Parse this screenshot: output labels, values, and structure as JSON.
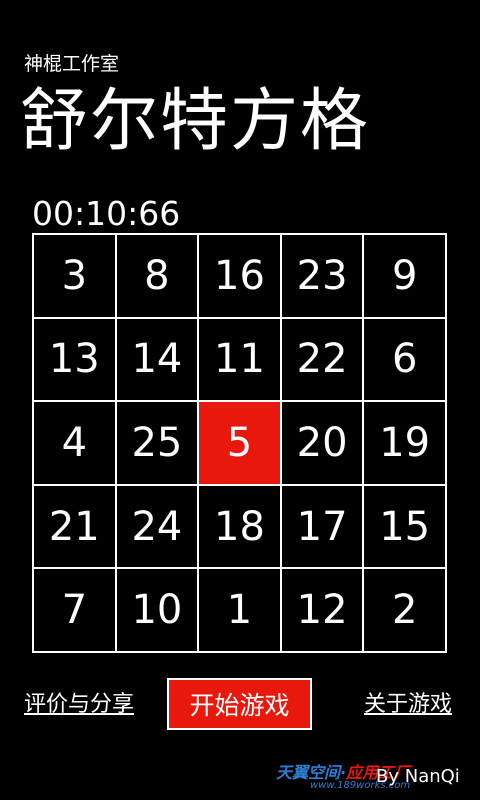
{
  "header": {
    "studio": "神棍工作室",
    "title": "舒尔特方格"
  },
  "timer": "00:10:66",
  "grid": {
    "cells": [
      "3",
      "8",
      "16",
      "23",
      "9",
      "13",
      "14",
      "11",
      "22",
      "6",
      "4",
      "25",
      "5",
      "20",
      "19",
      "21",
      "24",
      "18",
      "17",
      "15",
      "7",
      "10",
      "1",
      "12",
      "2"
    ],
    "highlight_color": "#e8190c"
  },
  "bottom": {
    "rate_share_label": "评价与分享",
    "start_label": "开始游戏",
    "about_label": "关于游戏"
  },
  "footer": {
    "logo_blue": "天翼空间",
    "logo_sep": "·",
    "logo_red": "应用工厂",
    "url": "www.189works.com",
    "author": "By NanQi"
  }
}
